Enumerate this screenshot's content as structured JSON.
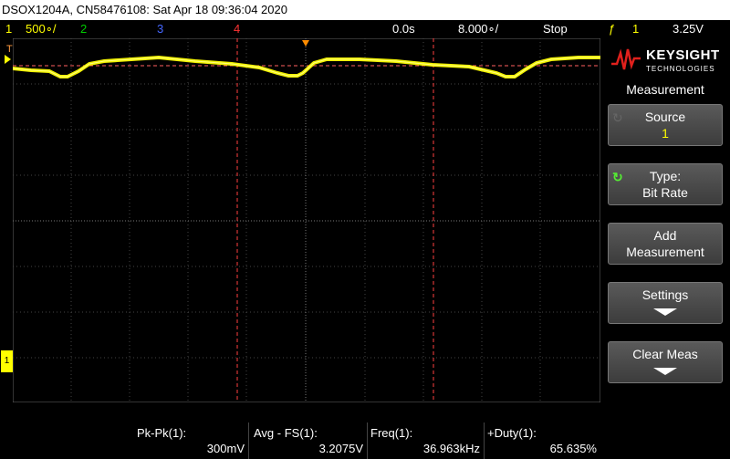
{
  "title": "DSOX1204A, CN58476108: Sat Apr 18 09:36:04 2020",
  "status": {
    "ch1_num": "1",
    "ch1_scale": "500∘/",
    "ch2_num": "2",
    "ch3_num": "3",
    "ch4_num": "4",
    "time_offset": "0.0s",
    "timebase": "8.000∘/",
    "run_state": "Stop",
    "trigger_icon": "ƒ",
    "trigger_source": "1",
    "trigger_level": "3.25V"
  },
  "colors": {
    "ch1": "#ffff00",
    "ch2": "#00cc00",
    "ch3": "#4466ff",
    "ch4": "#ff3333"
  },
  "markers": {
    "trigger_label": "T",
    "channel1_label": "1"
  },
  "panel": {
    "brand": "KEYSIGHT",
    "brand_sub": "TECHNOLOGIES",
    "title": "Measurement",
    "source_label": "Source",
    "source_value": "1",
    "type_label": "Type:",
    "type_value": "Bit Rate",
    "add_label_1": "Add",
    "add_label_2": "Measurement",
    "settings_label": "Settings",
    "clear_label": "Clear Meas"
  },
  "measurements": [
    {
      "label": "Pk-Pk(1):",
      "value": "300mV"
    },
    {
      "label": "Avg - FS(1):",
      "value": "3.2075V"
    },
    {
      "label": "Freq(1):",
      "value": "36.963kHz"
    },
    {
      "label": "+Duty(1):",
      "value": "65.635%"
    }
  ]
}
